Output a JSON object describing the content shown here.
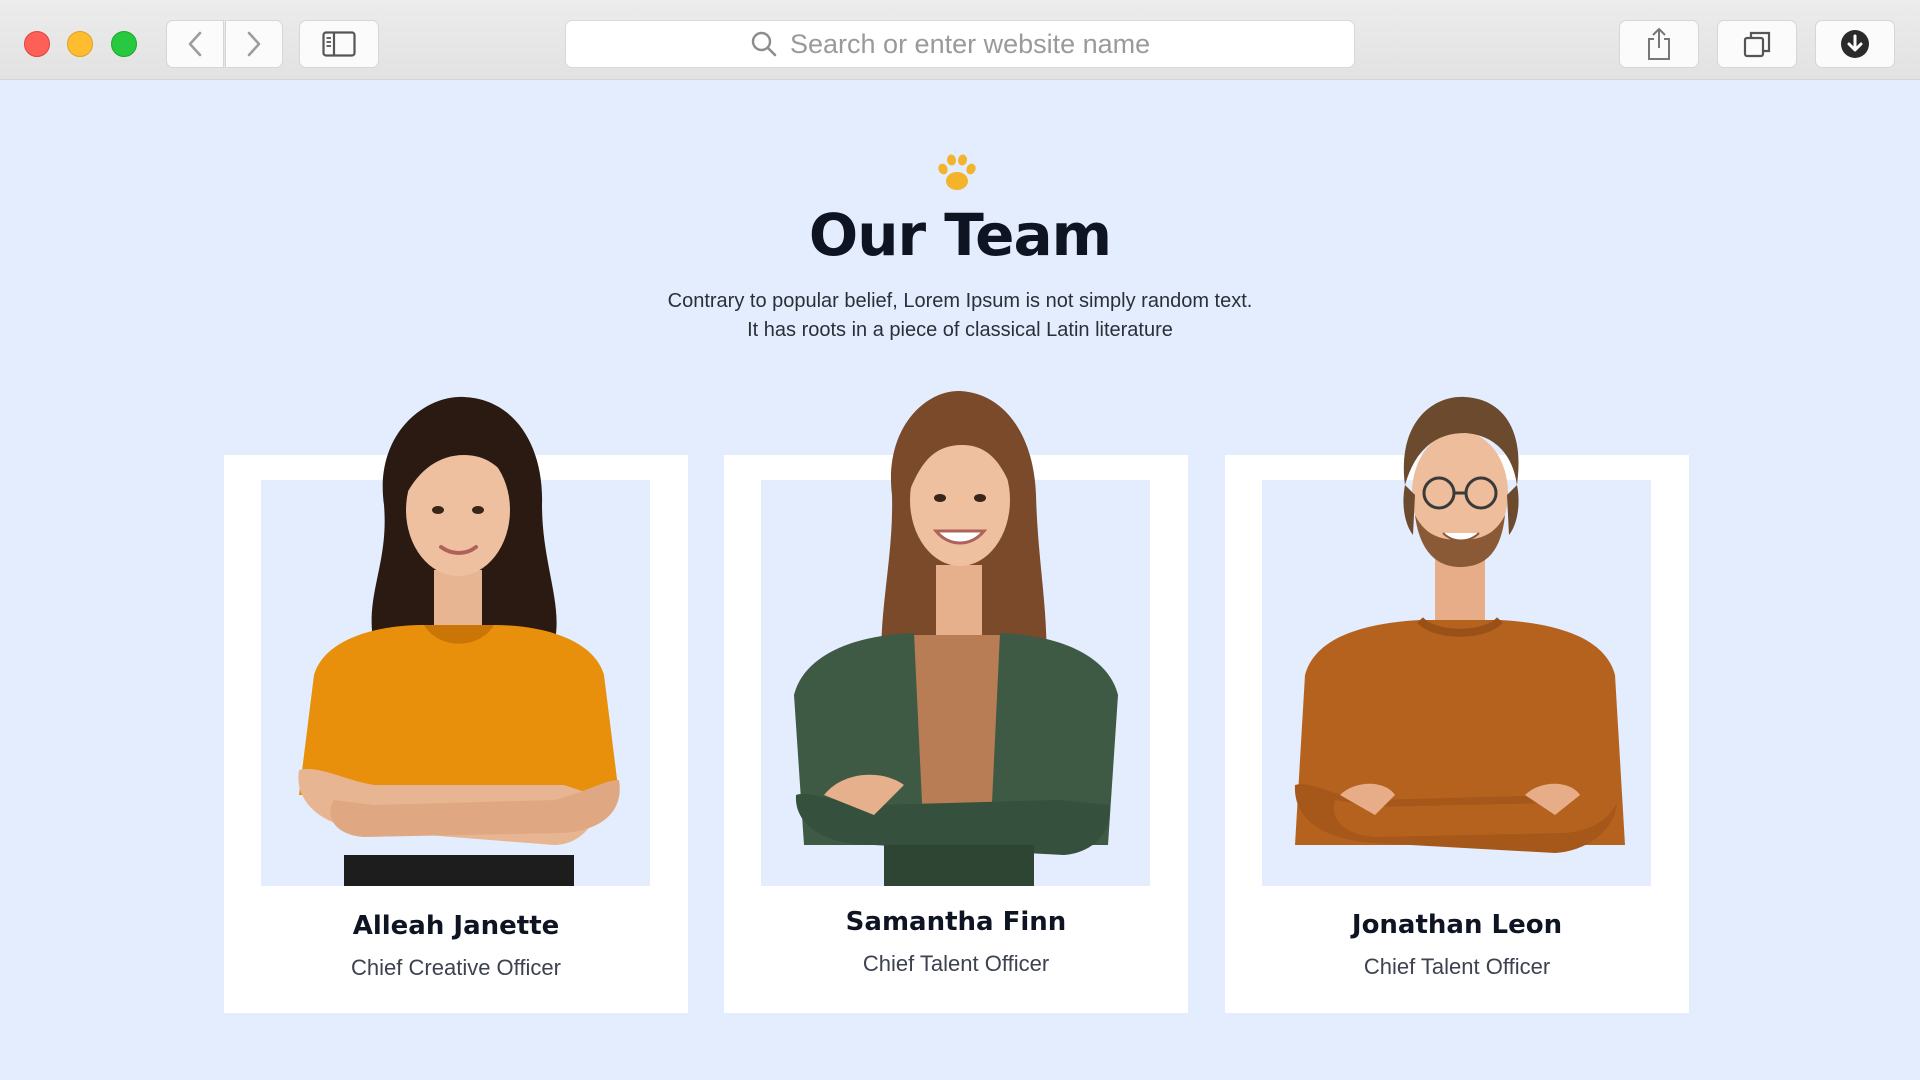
{
  "browser": {
    "address_placeholder": "Search or enter website name",
    "icons": {
      "back": "chevron-left-icon",
      "forward": "chevron-right-icon",
      "sidebar": "sidebar-icon",
      "search": "search-icon",
      "share": "share-icon",
      "tabs": "tabs-overview-icon",
      "downloads": "download-icon"
    }
  },
  "section": {
    "icon": "paw-icon",
    "title": "Our Team",
    "subtitle_line1": "Contrary to popular belief, Lorem Ipsum is not simply random text.",
    "subtitle_line2": "It has roots in a piece of classical Latin literature"
  },
  "team": [
    {
      "name": "Alleah Janette",
      "role": "Chief Creative Officer",
      "shirt_color": "#e8900c",
      "hair_color": "#2b1a12"
    },
    {
      "name": "Samantha Finn",
      "role": "Chief Talent Officer",
      "shirt_color": "#3e5a45",
      "hair_color": "#7a4a2a"
    },
    {
      "name": "Jonathan Leon",
      "role": "Chief Talent Officer",
      "shirt_color": "#b5621f",
      "hair_color": "#6b4a2e"
    }
  ],
  "colors": {
    "page_background": "#e3edfe",
    "card_background": "#ffffff",
    "heading": "#0e1422",
    "accent_paw": "#f3b32a"
  }
}
